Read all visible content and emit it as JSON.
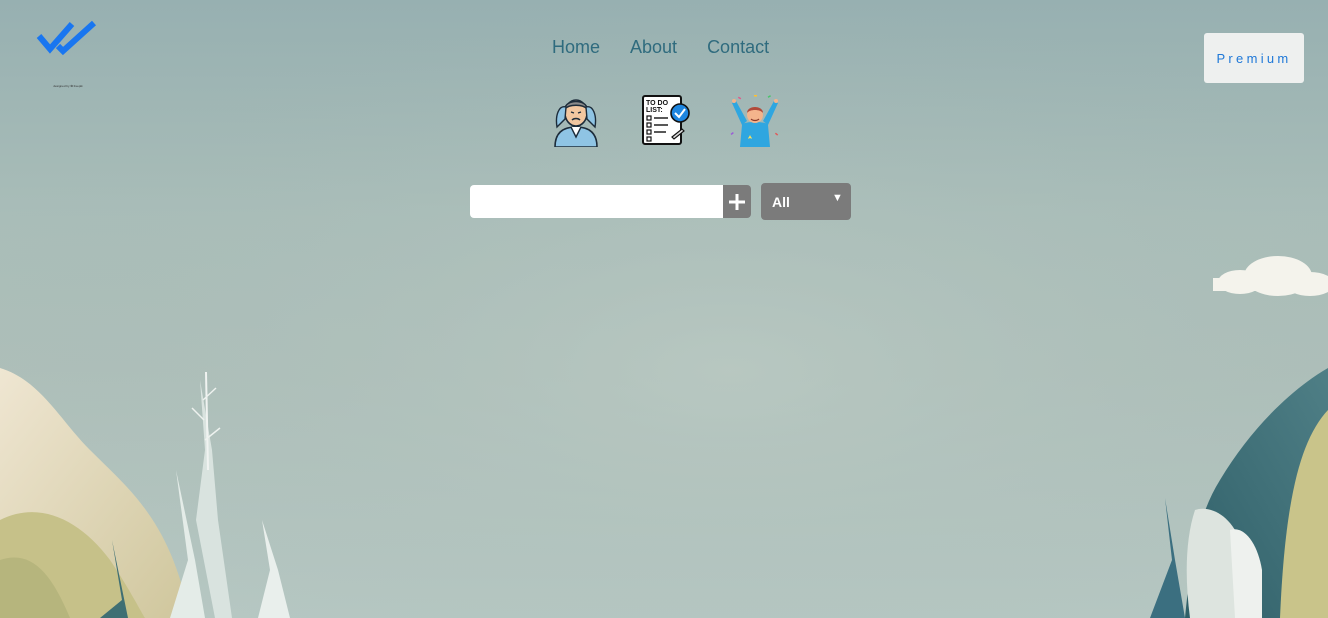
{
  "logo": {
    "icon": "double-check-icon",
    "caption": "designed by ✿ freepik",
    "color": "#1976f0"
  },
  "nav": {
    "items": [
      {
        "label": "Home"
      },
      {
        "label": "About"
      },
      {
        "label": "Contact"
      }
    ]
  },
  "premium_button": {
    "label": "Premium",
    "color": "#1e78d8"
  },
  "illustrations": [
    {
      "icon": "stressed-person-icon"
    },
    {
      "icon": "todo-list-checklist-icon"
    },
    {
      "icon": "celebrating-person-icon"
    }
  ],
  "todo_form": {
    "input_value": "",
    "input_placeholder": "",
    "add_icon": "plus-icon"
  },
  "filter": {
    "selected": "All",
    "caret_icon": "caret-down-icon"
  }
}
